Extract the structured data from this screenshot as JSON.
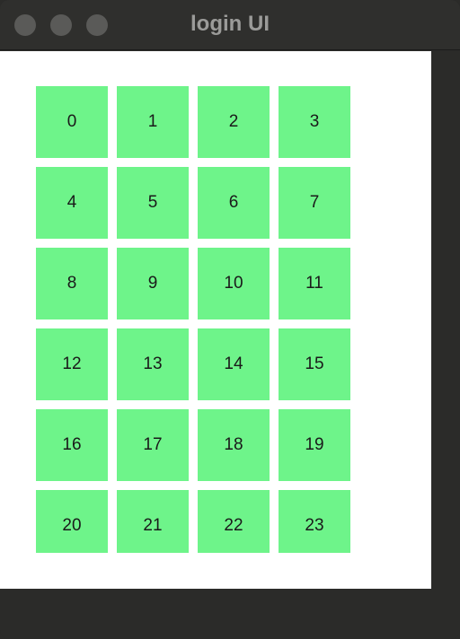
{
  "window": {
    "title": "login UI"
  },
  "grid": {
    "cells": [
      "0",
      "1",
      "2",
      "3",
      "4",
      "5",
      "6",
      "7",
      "8",
      "9",
      "10",
      "11",
      "12",
      "13",
      "14",
      "15",
      "16",
      "17",
      "18",
      "19",
      "20",
      "21",
      "22",
      "23"
    ]
  },
  "colors": {
    "cell_background": "#6ef48a",
    "window_chrome": "#2b2b29",
    "content_background": "#ffffff"
  }
}
